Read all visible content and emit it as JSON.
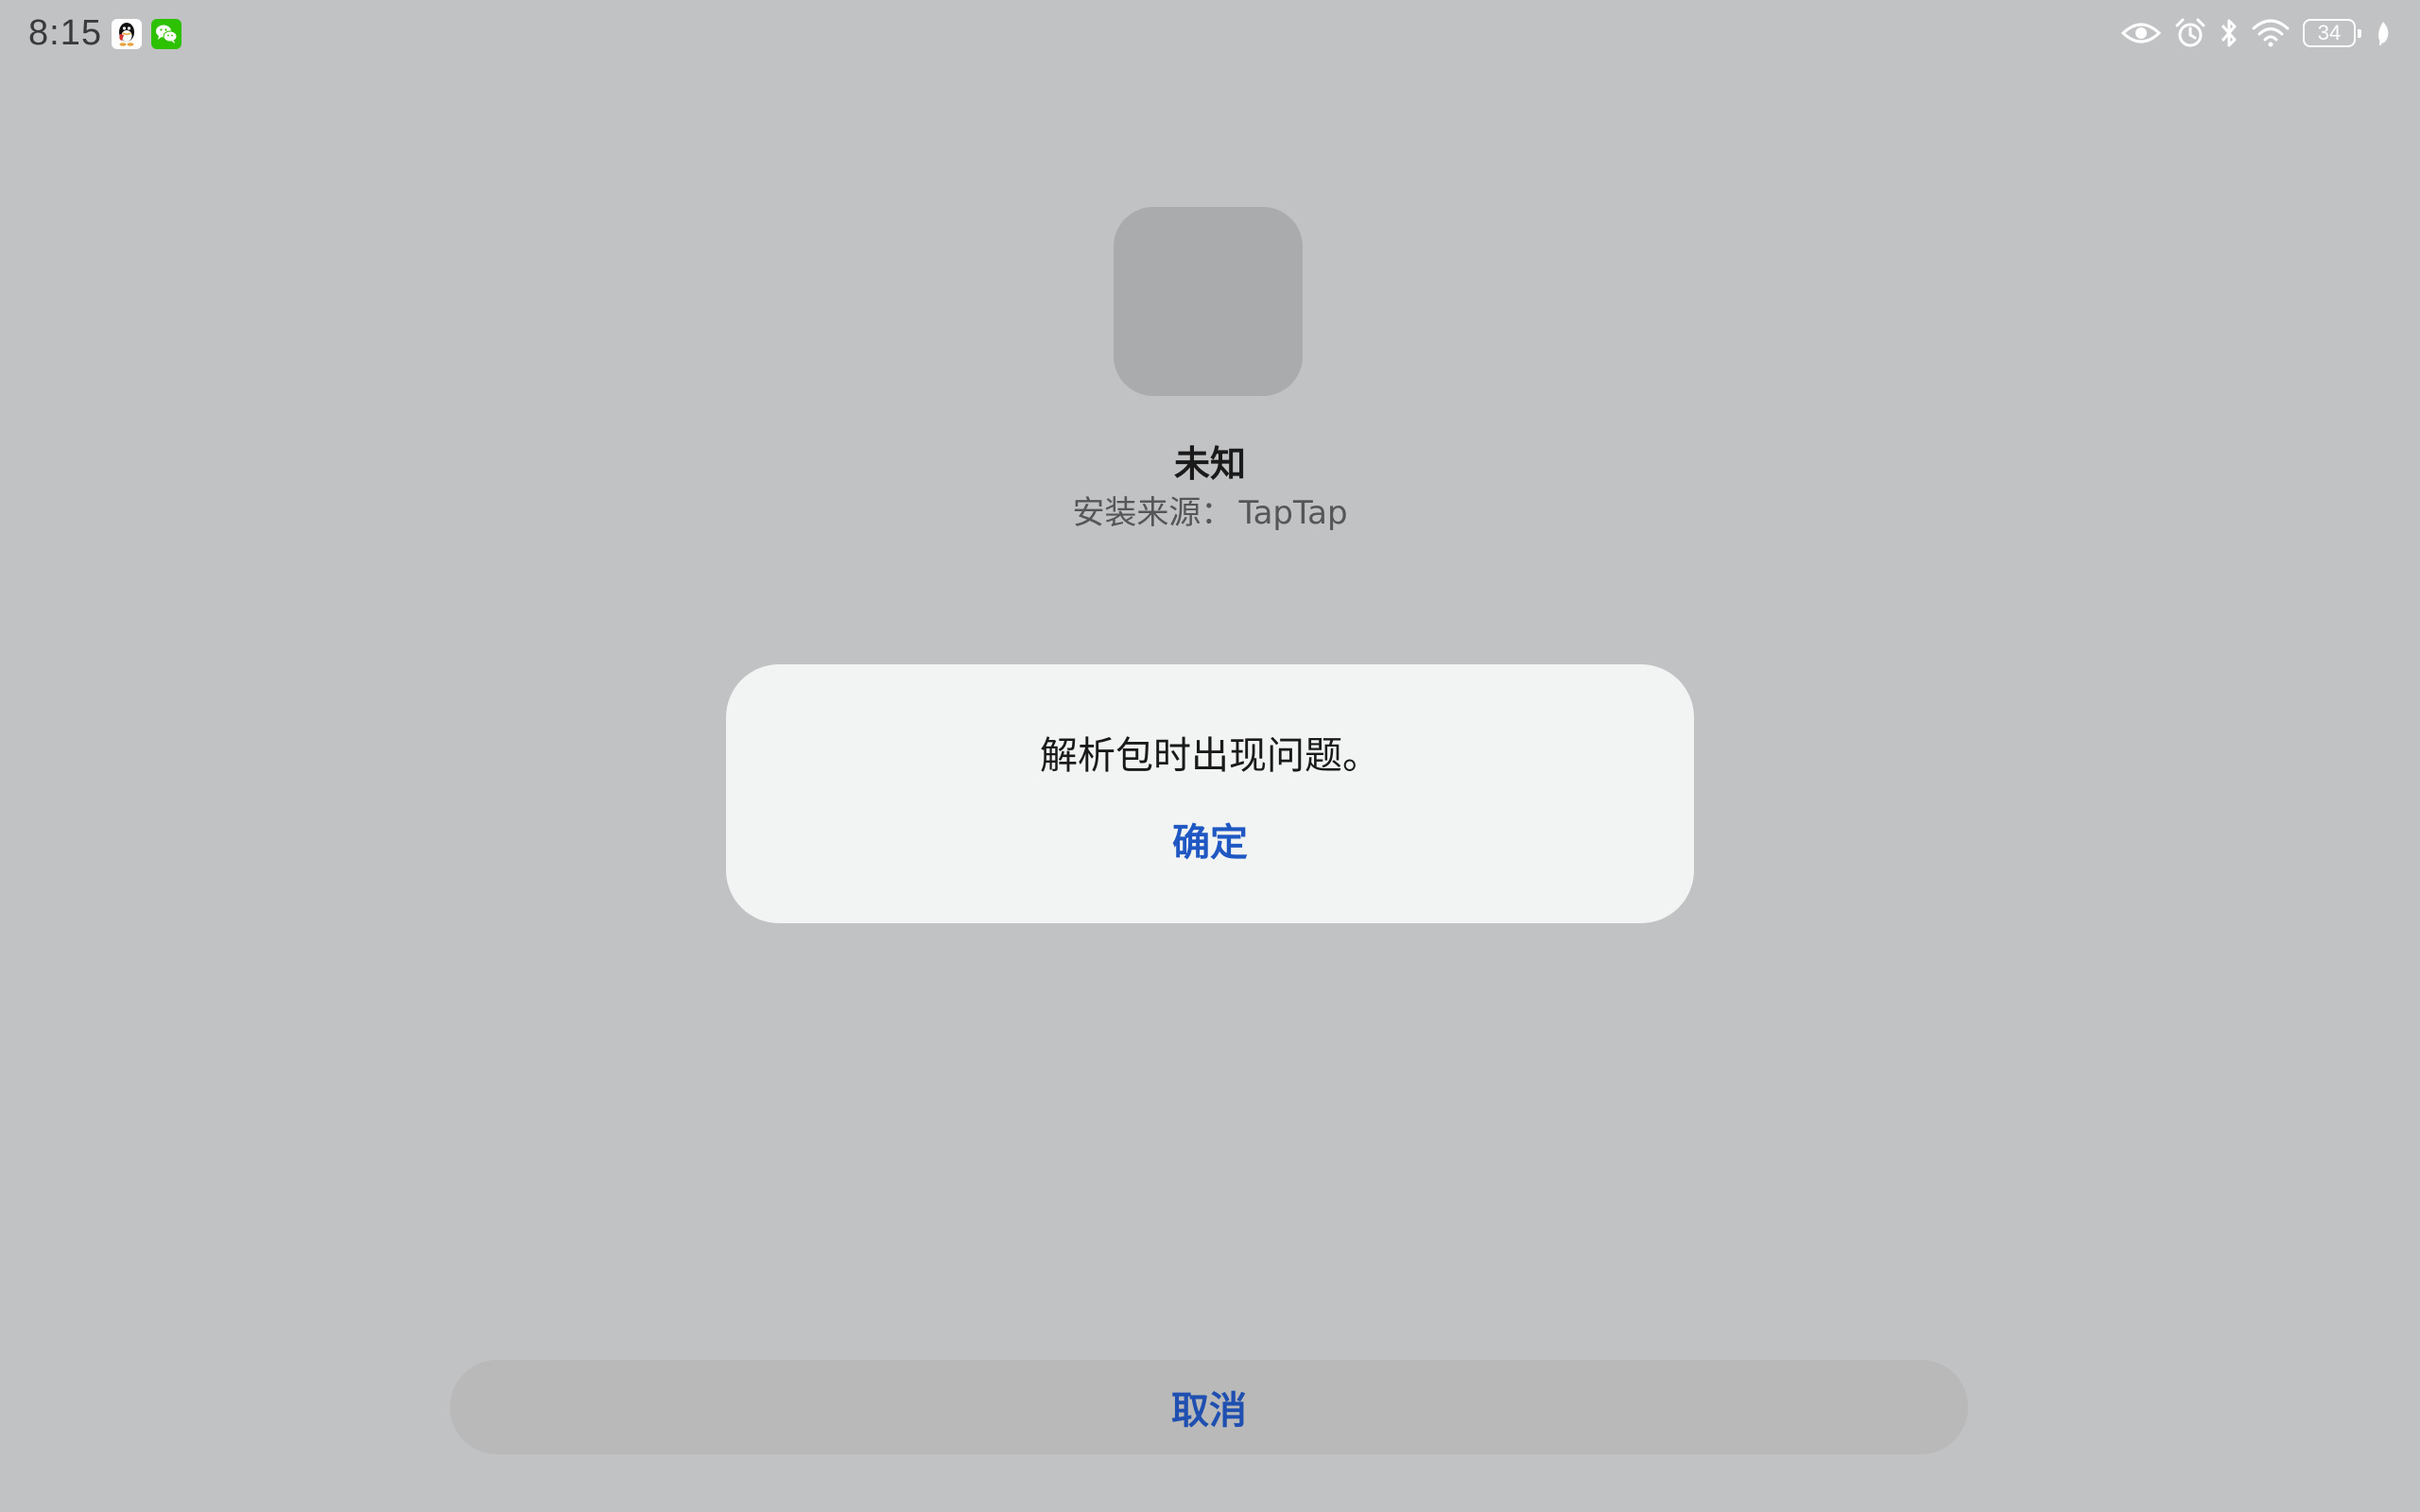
{
  "status_bar": {
    "time": "8:15",
    "notifications": [
      "qq-icon",
      "wechat-icon"
    ],
    "system_icons": [
      "eye-icon",
      "alarm-icon",
      "bluetooth-icon",
      "wifi-icon",
      "battery-icon",
      "leaf-icon"
    ],
    "battery_level": "34"
  },
  "app": {
    "name": "未知",
    "install_source_label": "安装来源：",
    "install_source_value": "TapTap"
  },
  "dialog": {
    "message": "解析包时出现问题。",
    "confirm_label": "确定"
  },
  "footer": {
    "cancel_label": "取消"
  },
  "colors": {
    "background": "#c1c2c4",
    "dialog_background": "#f2f3f3",
    "accent": "#1f57c3",
    "cancel_background": "#b8b9b8"
  }
}
